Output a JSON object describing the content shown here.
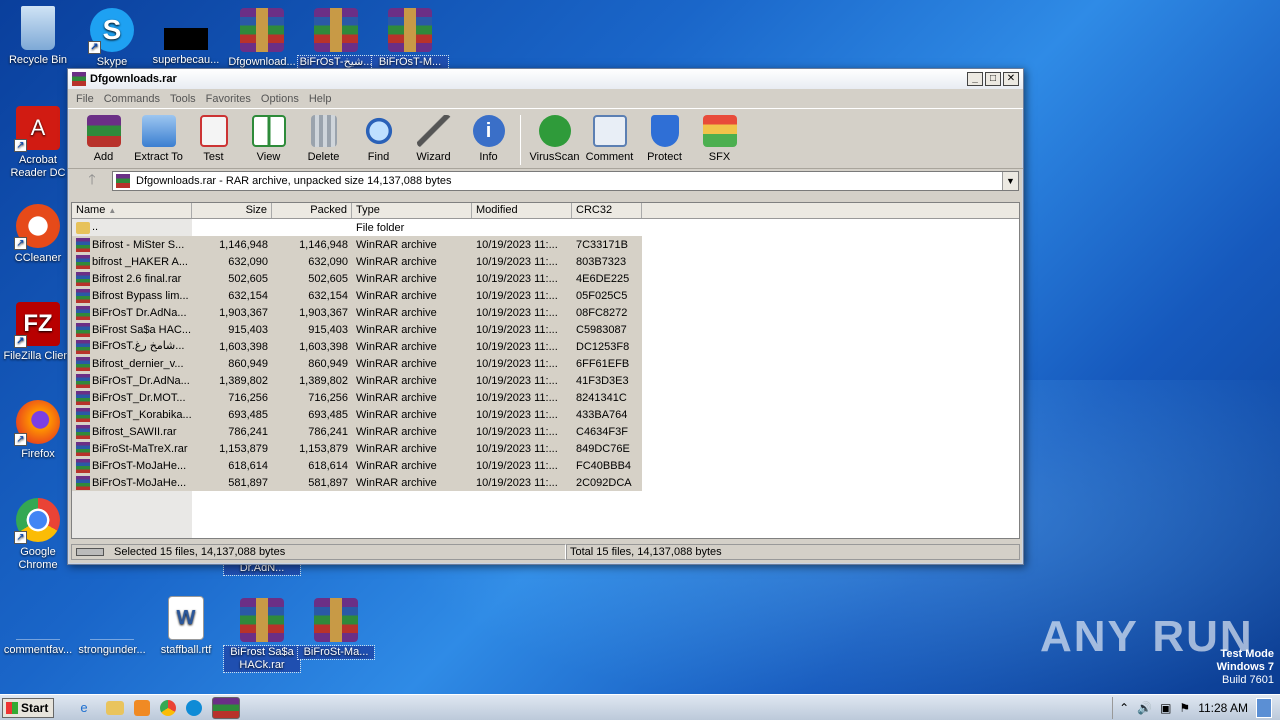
{
  "desktop": {
    "icons": [
      {
        "label": "Recycle Bin"
      },
      {
        "label": "Skype"
      },
      {
        "label": "superbecau..."
      },
      {
        "label": "Dfgownload..."
      },
      {
        "label": "BiFrOsT-شيخ..."
      },
      {
        "label": "BiFrOsT-M..."
      },
      {
        "label": "Acrobat Reader DC"
      },
      {
        "label": "CCleaner"
      },
      {
        "label": "FileZilla Client"
      },
      {
        "label": "Firefox"
      },
      {
        "label": "Google Chrome"
      },
      {
        "label": "Dr.AdN..."
      },
      {
        "label": "commentfav..."
      },
      {
        "label": "strongunder..."
      },
      {
        "label": "staffball.rtf"
      },
      {
        "label": "BiFrost Sa$a HACk.rar"
      },
      {
        "label": "BiFroSt-Ma..."
      }
    ]
  },
  "window": {
    "title": "Dfgownloads.rar",
    "menu": [
      "File",
      "Commands",
      "Tools",
      "Favorites",
      "Options",
      "Help"
    ],
    "toolbar": [
      "Add",
      "Extract To",
      "Test",
      "View",
      "Delete",
      "Find",
      "Wizard",
      "Info",
      "VirusScan",
      "Comment",
      "Protect",
      "SFX"
    ],
    "address": "Dfgownloads.rar - RAR archive, unpacked size 14,137,088 bytes",
    "columns": [
      "Name",
      "Size",
      "Packed",
      "Type",
      "Modified",
      "CRC32"
    ],
    "parent_row": {
      "name": "..",
      "type": "File folder"
    },
    "files": [
      {
        "name": "Bifrost - MiSter S...",
        "size": "1,146,948",
        "packed": "1,146,948",
        "type": "WinRAR archive",
        "modified": "10/19/2023 11:...",
        "crc": "7C33171B"
      },
      {
        "name": "bifrost _HAKER A...",
        "size": "632,090",
        "packed": "632,090",
        "type": "WinRAR archive",
        "modified": "10/19/2023 11:...",
        "crc": "803B7323"
      },
      {
        "name": "Bifrost 2.6 final.rar",
        "size": "502,605",
        "packed": "502,605",
        "type": "WinRAR archive",
        "modified": "10/19/2023 11:...",
        "crc": "4E6DE225"
      },
      {
        "name": "Bifrost Bypass lim...",
        "size": "632,154",
        "packed": "632,154",
        "type": "WinRAR archive",
        "modified": "10/19/2023 11:...",
        "crc": "05F025C5"
      },
      {
        "name": "BiFrOsT Dr.AdNa...",
        "size": "1,903,367",
        "packed": "1,903,367",
        "type": "WinRAR archive",
        "modified": "10/19/2023 11:...",
        "crc": "08FC8272"
      },
      {
        "name": "BiFrost Sa$a HAC...",
        "size": "915,403",
        "packed": "915,403",
        "type": "WinRAR archive",
        "modified": "10/19/2023 11:...",
        "crc": "C5983087"
      },
      {
        "name": "BiFrOsT.شامخ رغ...",
        "size": "1,603,398",
        "packed": "1,603,398",
        "type": "WinRAR archive",
        "modified": "10/19/2023 11:...",
        "crc": "DC1253F8"
      },
      {
        "name": "Bifrost_dernier_v...",
        "size": "860,949",
        "packed": "860,949",
        "type": "WinRAR archive",
        "modified": "10/19/2023 11:...",
        "crc": "6FF61EFB"
      },
      {
        "name": "BiFrOsT_Dr.AdNa...",
        "size": "1,389,802",
        "packed": "1,389,802",
        "type": "WinRAR archive",
        "modified": "10/19/2023 11:...",
        "crc": "41F3D3E3"
      },
      {
        "name": "BiFrOsT_Dr.MOT...",
        "size": "716,256",
        "packed": "716,256",
        "type": "WinRAR archive",
        "modified": "10/19/2023 11:...",
        "crc": "8241341C"
      },
      {
        "name": "BiFrOsT_Korabika...",
        "size": "693,485",
        "packed": "693,485",
        "type": "WinRAR archive",
        "modified": "10/19/2023 11:...",
        "crc": "433BA764"
      },
      {
        "name": "Bifrost_SAWII.rar",
        "size": "786,241",
        "packed": "786,241",
        "type": "WinRAR archive",
        "modified": "10/19/2023 11:...",
        "crc": "C4634F3F"
      },
      {
        "name": "BiFroSt-MaTreX.rar",
        "size": "1,153,879",
        "packed": "1,153,879",
        "type": "WinRAR archive",
        "modified": "10/19/2023 11:...",
        "crc": "849DC76E"
      },
      {
        "name": "BiFrOsT-MoJaHe...",
        "size": "618,614",
        "packed": "618,614",
        "type": "WinRAR archive",
        "modified": "10/19/2023 11:...",
        "crc": "FC40BBB4"
      },
      {
        "name": "BiFrOsT-MoJaHe...",
        "size": "581,897",
        "packed": "581,897",
        "type": "WinRAR archive",
        "modified": "10/19/2023 11:...",
        "crc": "2C092DCA"
      }
    ],
    "status_left": "Selected 15 files, 14,137,088 bytes",
    "status_right": "Total 15 files, 14,137,088 bytes"
  },
  "taskbar": {
    "start": "Start",
    "clock": "11:28 AM"
  },
  "watermark": {
    "brand": "ANY RUN",
    "mode": "Test Mode",
    "os": "Windows 7",
    "build": "Build 7601"
  }
}
